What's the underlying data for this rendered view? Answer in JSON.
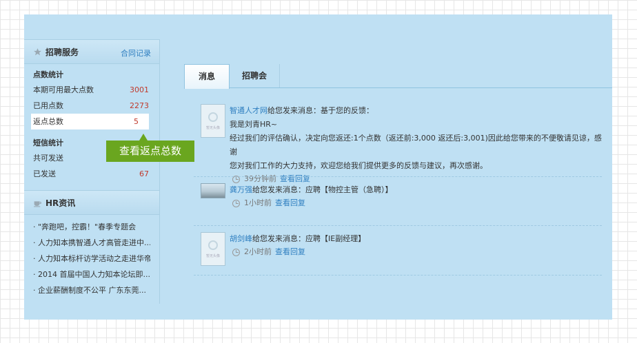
{
  "sidebar": {
    "recruit": {
      "title": "招聘服务",
      "link": "合同记录",
      "points": {
        "title": "点数统计",
        "rows": [
          {
            "label": "本期可用最大点数",
            "value": "3001"
          },
          {
            "label": "已用点数",
            "value": "2273"
          },
          {
            "label": "返点总数",
            "value": "5"
          }
        ]
      },
      "sms": {
        "title": "短信统计",
        "rows": [
          {
            "label": "共可发送",
            "value": ""
          },
          {
            "label": "已发送",
            "value": "67"
          }
        ]
      }
    },
    "hr": {
      "title": "HR资讯",
      "items": [
        "\"奔跑吧，控霸！\"春季专题会",
        "人力知本携智通人才高管走进中...",
        "人力知本标杆访学活动之走进华帝",
        "2014 首届中国人力知本论坛即...",
        "企业薪酬制度不公平 广东东莞..."
      ]
    }
  },
  "tooltip": {
    "text": "查看返点总数"
  },
  "tabs": [
    {
      "label": "消息"
    },
    {
      "label": "招聘会"
    }
  ],
  "messages": [
    {
      "sender": "智通人才网",
      "subject": "给您发来消息：基于您的反馈：",
      "lines": [
        "我是刘青HR~",
        "经过我们的评估确认，决定向您返还:1个点数（返还前:3,000 返还后:3,001)因此给您带来的不便敬请见谅，感谢",
        "您对我们工作的大力支持，欢迎您给我们提供更多的反馈与建议，再次感谢。"
      ],
      "time": "39分钟前",
      "reply": "查看回复",
      "avatar_label": "暂无头像"
    },
    {
      "sender": "龚万强",
      "subject": "给您发来消息：应聘【物控主管（急聘）】",
      "lines": [],
      "time": "1小时前",
      "reply": "查看回复"
    },
    {
      "sender": "胡剑峰",
      "subject": "给您发来消息：应聘【IE副经理】",
      "lines": [],
      "time": "2小时前",
      "reply": "查看回复",
      "avatar_label": "暂无头像"
    }
  ],
  "colors": {
    "panel": "#bfe0f3",
    "link": "#2f7fc0",
    "number": "#c0392b",
    "tooltip": "#6aa61f"
  }
}
